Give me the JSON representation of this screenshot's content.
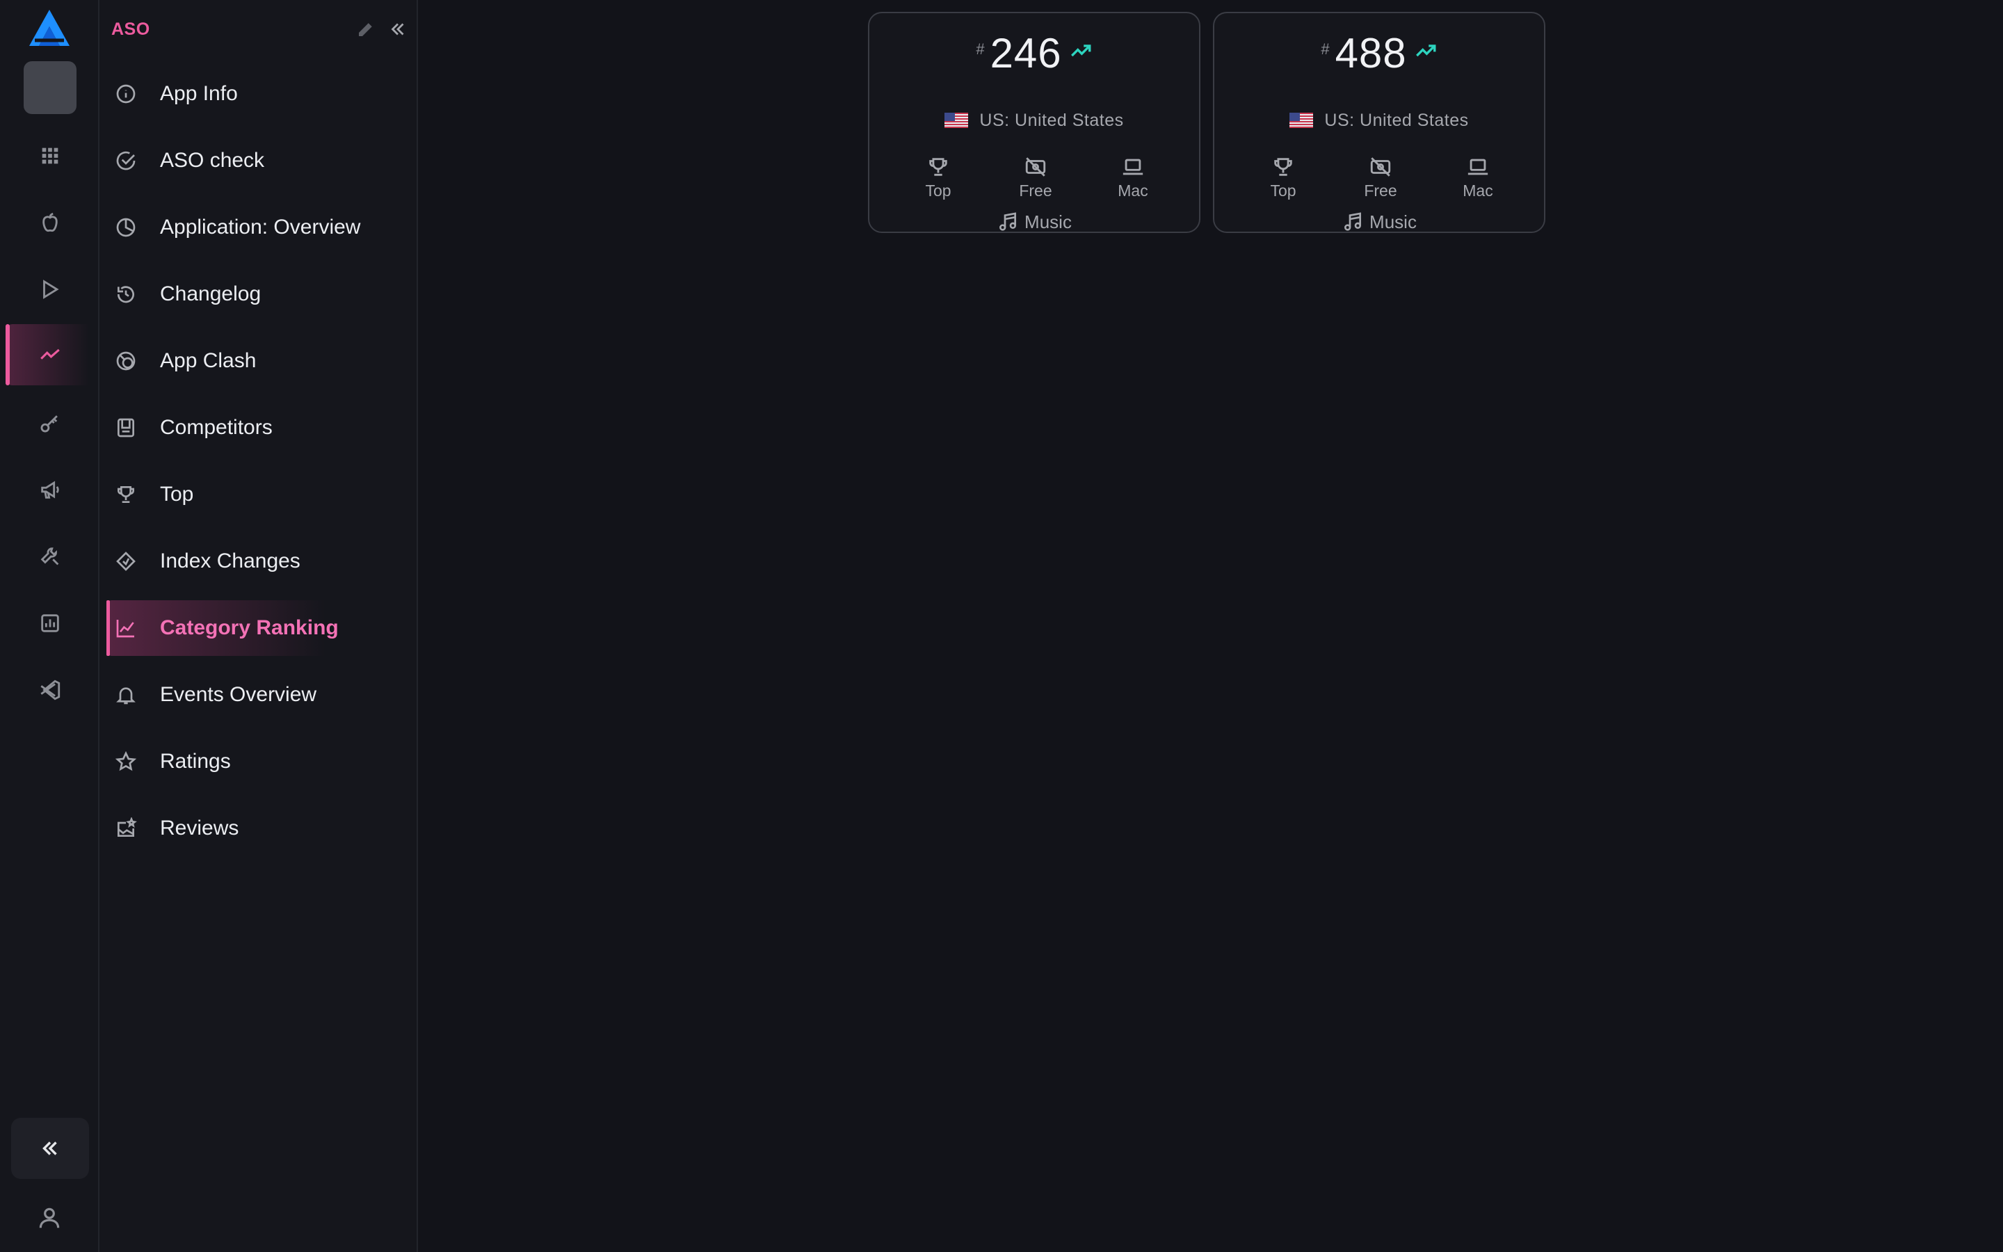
{
  "sidebar": {
    "title": "ASO",
    "items": [
      {
        "label": "App Info",
        "icon": "info-icon"
      },
      {
        "label": "ASO check",
        "icon": "check-circle-icon"
      },
      {
        "label": "Application: Overview",
        "icon": "pie-chart-icon"
      },
      {
        "label": "Changelog",
        "icon": "history-icon"
      },
      {
        "label": "App Clash",
        "icon": "clash-icon"
      },
      {
        "label": "Competitors",
        "icon": "competitors-icon"
      },
      {
        "label": "Top",
        "icon": "trophy-icon"
      },
      {
        "label": "Index Changes",
        "icon": "index-icon"
      },
      {
        "label": "Category Ranking",
        "icon": "line-chart-icon",
        "active": true
      },
      {
        "label": "Events Overview",
        "icon": "bell-icon"
      },
      {
        "label": "Ratings",
        "icon": "star-icon"
      },
      {
        "label": "Reviews",
        "icon": "reviews-icon"
      }
    ]
  },
  "rail": {
    "items": [
      "grid-icon",
      "apple-icon",
      "play-store-icon",
      "trend-icon",
      "key-icon",
      "megaphone-icon",
      "tools-icon",
      "report-icon",
      "vscode-icon"
    ],
    "active_index": 3
  },
  "cards": [
    {
      "hash": "#",
      "rank": "246",
      "country": "US: United States",
      "chart": "Top",
      "price": "Free",
      "device": "Mac",
      "genre": "Music"
    },
    {
      "hash": "#",
      "rank": "488",
      "country": "US: United States",
      "chart": "Top",
      "price": "Free",
      "device": "Mac",
      "genre": "Music"
    }
  ],
  "colors": {
    "accent": "#ec5b9e",
    "trend_up": "#2dd4bf",
    "background": "#121319"
  }
}
